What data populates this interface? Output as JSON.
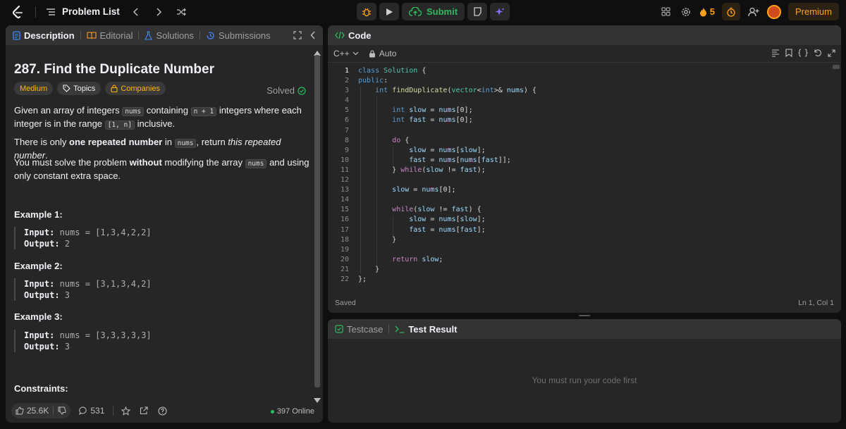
{
  "nav": {
    "problem_list": "Problem List",
    "submit": "Submit",
    "streak": "5",
    "premium": "Premium"
  },
  "desc_panel": {
    "tabs": [
      "Description",
      "Editorial",
      "Solutions",
      "Submissions"
    ],
    "title": "287. Find the Duplicate Number",
    "solved": "Solved",
    "chips": {
      "difficulty": "Medium",
      "topics": "Topics",
      "companies": "Companies"
    },
    "p1": {
      "a": "Given an array of integers ",
      "c1": "nums",
      "b": " containing ",
      "c2": "n + 1",
      "c": " integers where each integer is in the range ",
      "c3": "[1, n]",
      "d": " inclusive."
    },
    "p2": {
      "a": "There is only ",
      "bold": "one repeated number",
      "b": " in ",
      "c1": "nums",
      "c": ", return ",
      "em": "this repeated number",
      "d": "."
    },
    "p3": {
      "a": "You must solve the problem ",
      "bold": "without",
      "b": " modifying the array ",
      "c1": "nums",
      "c": " and using only constant extra space."
    },
    "examples": [
      {
        "heading": "Example 1:",
        "input_label": "Input:",
        "input": " nums = [1,3,4,2,2]",
        "output_label": "Output:",
        "output": " 2"
      },
      {
        "heading": "Example 2:",
        "input_label": "Input:",
        "input": " nums = [3,1,3,4,2]",
        "output_label": "Output:",
        "output": " 3"
      },
      {
        "heading": "Example 3:",
        "input_label": "Input:",
        "input": " nums = [3,3,3,3,3]",
        "output_label": "Output:",
        "output": " 3"
      }
    ],
    "constraints": "Constraints:",
    "footer": {
      "likes": "25.6K",
      "comments": "531",
      "online": "397 Online"
    }
  },
  "code_panel": {
    "tab": "Code",
    "language": "C++",
    "mode": "Auto",
    "status_left": "Saved",
    "status_right": "Ln 1, Col 1"
  },
  "test_panel": {
    "tabs": [
      "Testcase",
      "Test Result"
    ],
    "message": "You must run your code first"
  },
  "colors": {
    "accent": "#ffa116",
    "success": "#2cbb5d",
    "panel": "#262626"
  }
}
